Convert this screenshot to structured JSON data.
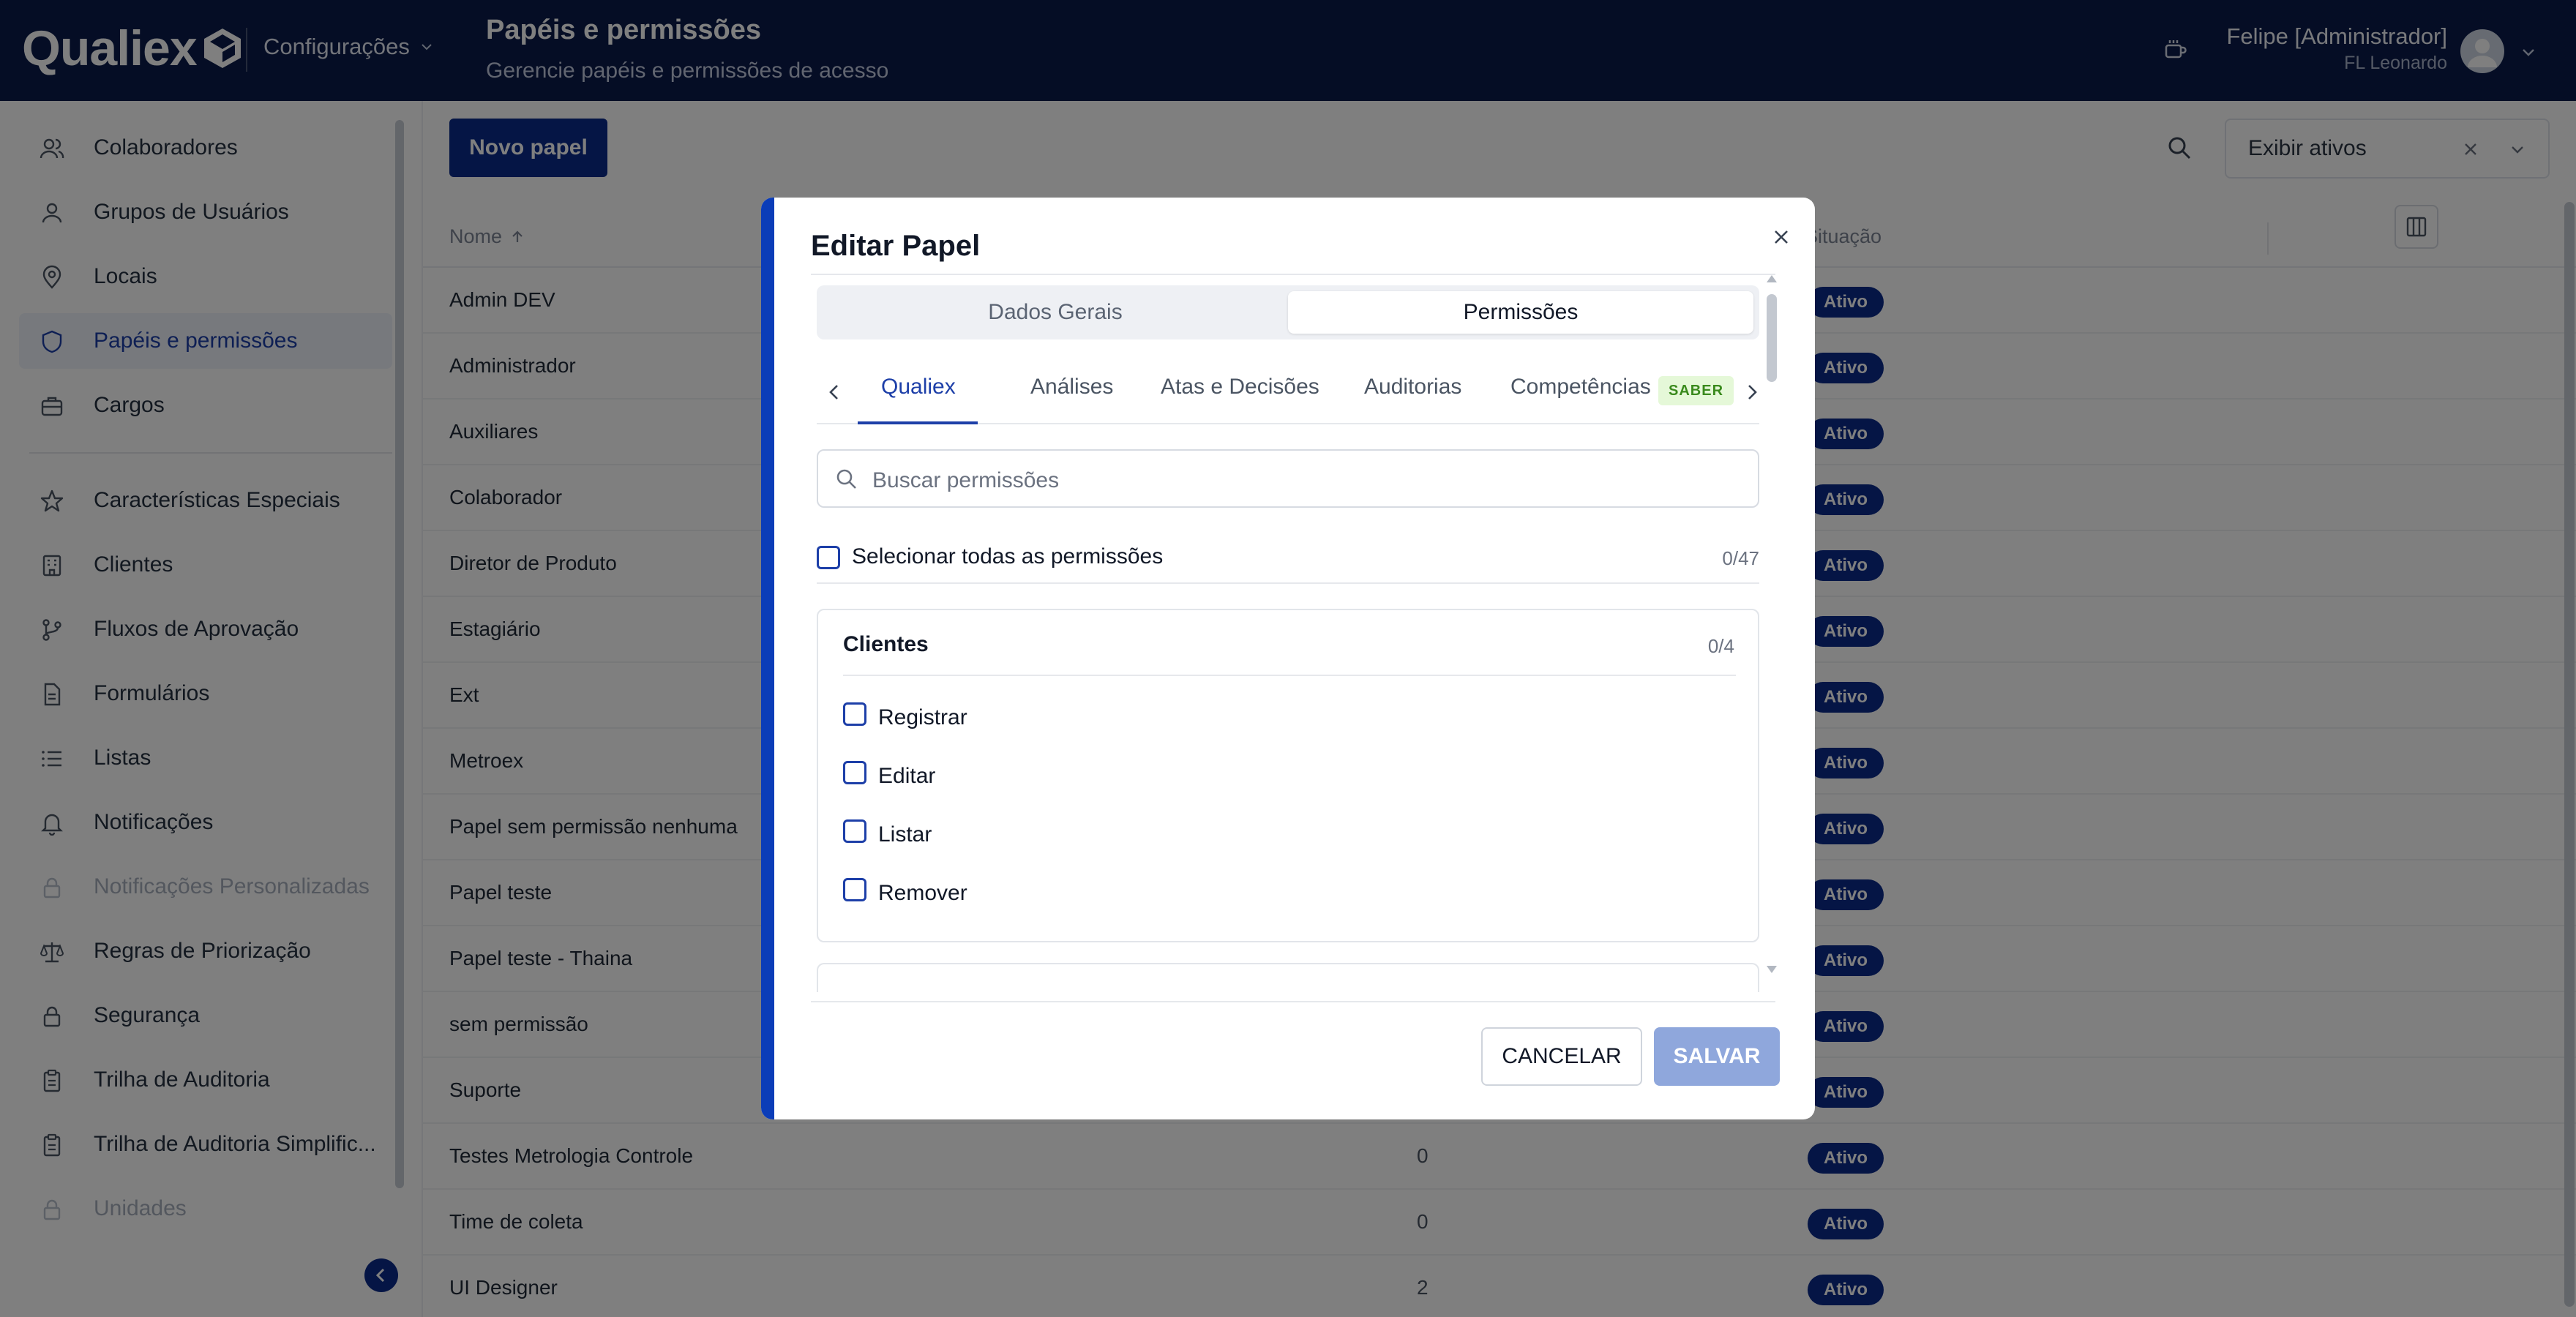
{
  "app": {
    "logo_text": "Qualiex",
    "module": "Configurações",
    "page_title": "Papéis e permissões",
    "page_subtitle": "Gerencie papéis e permissões de acesso",
    "user_name": "Felipe [Administrador]",
    "user_org": "FL Leonardo"
  },
  "sidebar": {
    "items": [
      {
        "label": "Colaboradores",
        "icon": "users-icon"
      },
      {
        "label": "Grupos de Usuários",
        "icon": "user-group-icon"
      },
      {
        "label": "Locais",
        "icon": "map-pin-icon"
      },
      {
        "label": "Papéis e permissões",
        "icon": "shield-icon"
      },
      {
        "label": "Cargos",
        "icon": "briefcase-icon"
      },
      {
        "label": "Características Especiais",
        "icon": "star-icon"
      },
      {
        "label": "Clientes",
        "icon": "building-icon"
      },
      {
        "label": "Fluxos de Aprovação",
        "icon": "git-branch-icon"
      },
      {
        "label": "Formulários",
        "icon": "document-icon"
      },
      {
        "label": "Listas",
        "icon": "list-icon"
      },
      {
        "label": "Notificações",
        "icon": "bell-icon"
      },
      {
        "label": "Notificações Personalizadas",
        "icon": "lock-icon"
      },
      {
        "label": "Regras de Priorização",
        "icon": "scale-icon"
      },
      {
        "label": "Segurança",
        "icon": "lock-icon"
      },
      {
        "label": "Trilha de Auditoria",
        "icon": "clipboard-icon"
      },
      {
        "label": "Trilha de Auditoria Simplific...",
        "icon": "clipboard-icon"
      },
      {
        "label": "Unidades",
        "icon": "lock-icon"
      }
    ]
  },
  "main": {
    "new_button": "Novo papel",
    "filter_value": "Exibir ativos",
    "columns": {
      "name": "Nome",
      "status": "Situação"
    },
    "rows": [
      {
        "name": "Admin DEV",
        "count": "",
        "status": "Ativo"
      },
      {
        "name": "Administrador",
        "count": "",
        "status": "Ativo"
      },
      {
        "name": "Auxiliares",
        "count": "",
        "status": "Ativo"
      },
      {
        "name": "Colaborador",
        "count": "",
        "status": "Ativo"
      },
      {
        "name": "Diretor de Produto",
        "count": "",
        "status": "Ativo"
      },
      {
        "name": "Estagiário",
        "count": "",
        "status": "Ativo"
      },
      {
        "name": "Ext",
        "count": "",
        "status": "Ativo"
      },
      {
        "name": "Metroex",
        "count": "",
        "status": "Ativo"
      },
      {
        "name": "Papel sem permissão nenhuma",
        "count": "",
        "status": "Ativo"
      },
      {
        "name": "Papel teste",
        "count": "",
        "status": "Ativo"
      },
      {
        "name": "Papel teste - Thaina",
        "count": "",
        "status": "Ativo"
      },
      {
        "name": "sem permissão",
        "count": "",
        "status": "Ativo"
      },
      {
        "name": "Suporte",
        "count": "",
        "status": "Ativo"
      },
      {
        "name": "Testes Metrologia Controle",
        "count": "0",
        "status": "Ativo"
      },
      {
        "name": "Time de coleta",
        "count": "0",
        "status": "Ativo"
      },
      {
        "name": "UI Designer",
        "count": "2",
        "status": "Ativo"
      }
    ]
  },
  "modal": {
    "title": "Editar Papel",
    "segments": [
      "Dados Gerais",
      "Permissões"
    ],
    "tabs": [
      "Qualiex",
      "Análises",
      "Atas e Decisões",
      "Auditorias",
      "Competências"
    ],
    "tab_tag": "SABER",
    "search_placeholder": "Buscar permissões",
    "select_all_label": "Selecionar todas as permissões",
    "select_all_count": "0/47",
    "group": {
      "title": "Clientes",
      "count": "0/4",
      "permissions": [
        "Registrar",
        "Editar",
        "Listar",
        "Remover"
      ]
    },
    "cancel_label": "CANCELAR",
    "save_label": "SALVAR"
  },
  "colors": {
    "topbar": "#0b1b4a",
    "primary": "#0b2a8a",
    "accent": "#1d3fa8",
    "save_disabled": "#8fa7dc",
    "tag_bg": "#e5f8d8"
  }
}
